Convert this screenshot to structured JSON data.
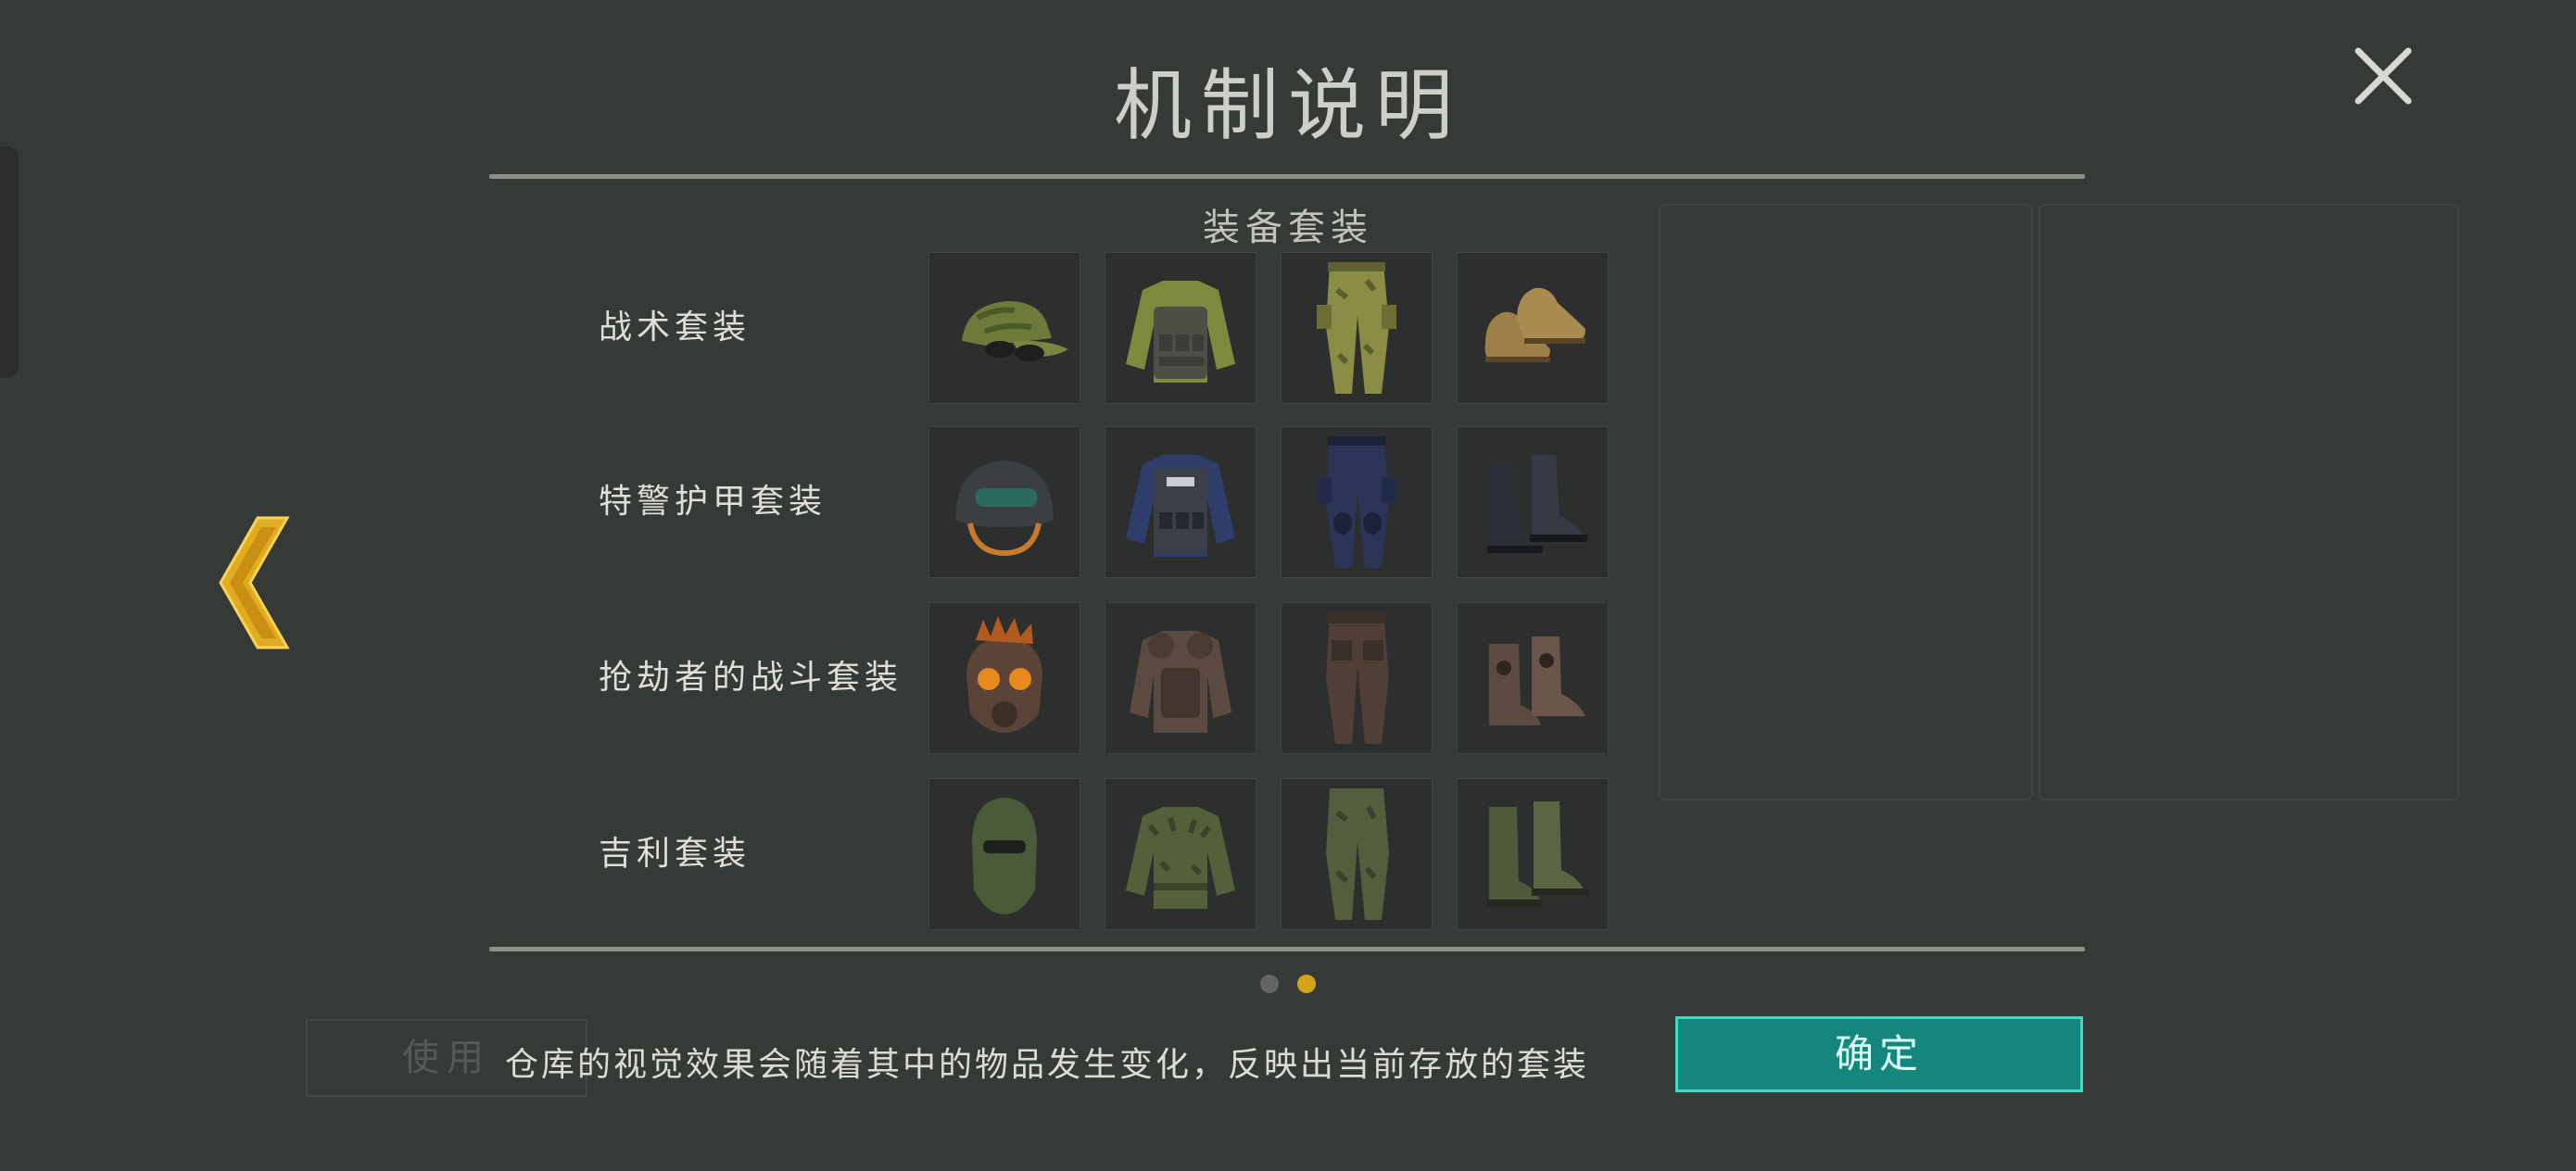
{
  "title": "机制说明",
  "subtitle": "装备套装",
  "sets": [
    {
      "label": "战术套装",
      "items": [
        "cap-icon",
        "tactical-vest-icon",
        "camo-pants-icon",
        "desert-shoes-icon"
      ]
    },
    {
      "label": "特警护甲套装",
      "items": [
        "swat-helmet-icon",
        "swat-vest-icon",
        "swat-pants-icon",
        "swat-boots-icon"
      ]
    },
    {
      "label": "抢劫者的战斗套装",
      "items": [
        "raider-mask-icon",
        "raider-armor-icon",
        "raider-pants-icon",
        "raider-boots-icon"
      ]
    },
    {
      "label": "吉利套装",
      "items": [
        "balaclava-icon",
        "ghillie-jacket-icon",
        "ghillie-pants-icon",
        "ghillie-boots-icon"
      ]
    }
  ],
  "footer_text": "仓库的视觉效果会随着其中的物品发生变化，反映出当前存放的套装",
  "confirm_label": "确定",
  "background_button_label": "使用",
  "pagination": {
    "total": 2,
    "current": 2
  },
  "colors": {
    "accent": "#d4a418",
    "confirm": "#14867c",
    "confirm_border": "#3ddbc8"
  }
}
